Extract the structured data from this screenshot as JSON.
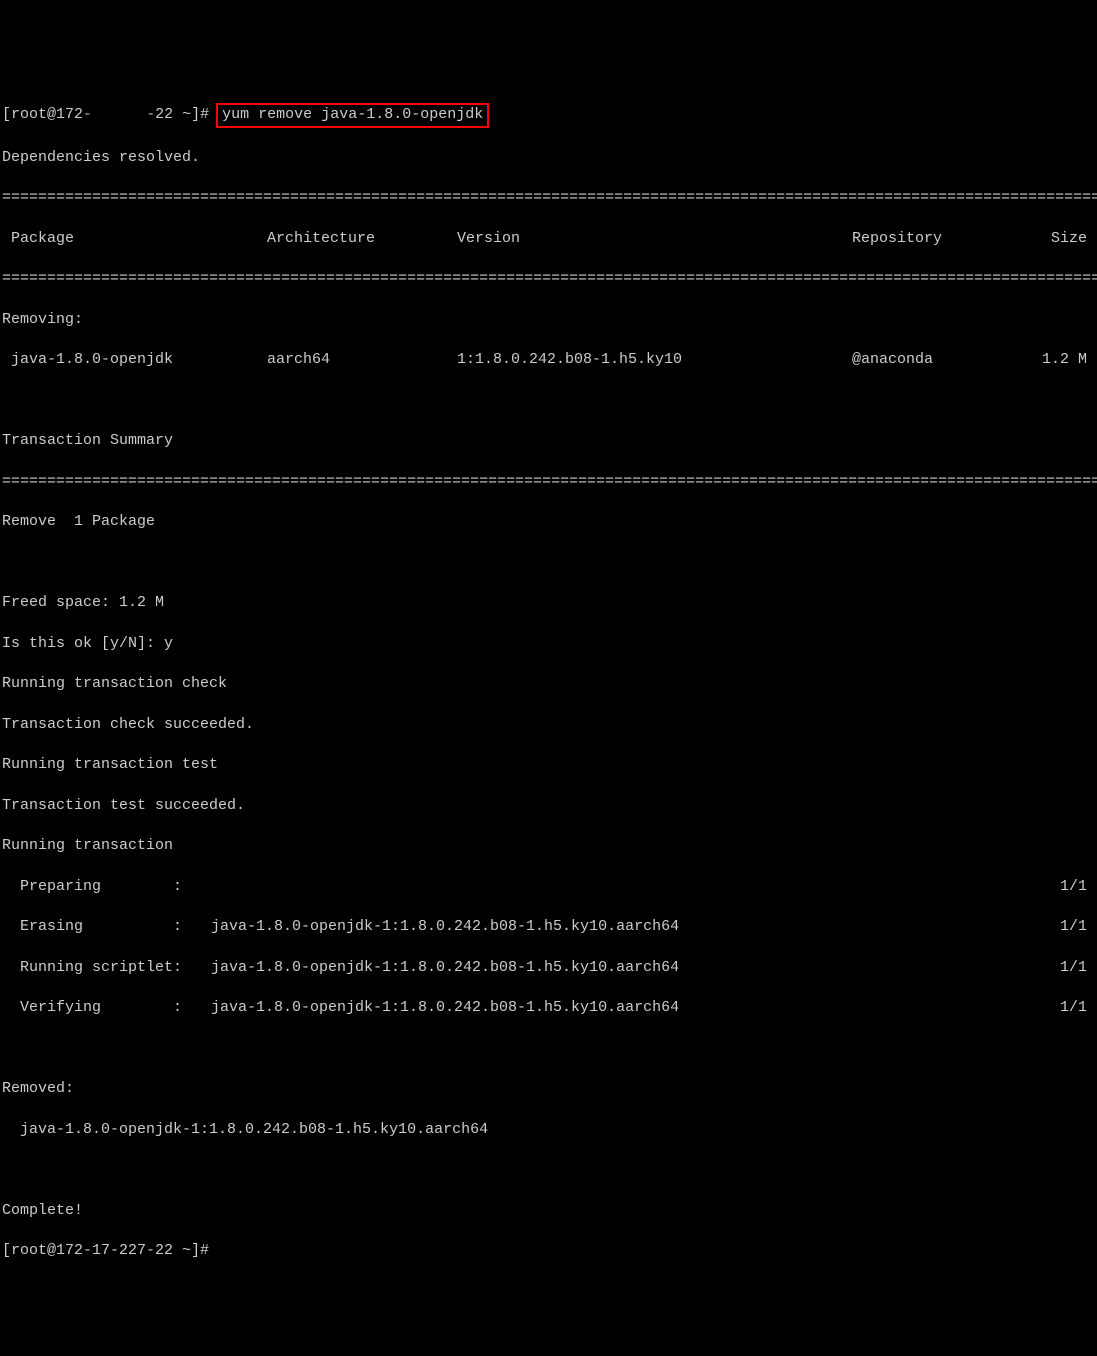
{
  "prompt1": {
    "user": "root",
    "host_prefix": "172-",
    "host_redacted": "17-227",
    "host_suffix": "-22",
    "path": "~",
    "symbol": "#",
    "command": "yum remove java-1.8.0-openjdk"
  },
  "deps_resolved": "Dependencies resolved.",
  "divider_single": "=================================================================================================================================",
  "headers": {
    "package": " Package",
    "arch": "Architecture",
    "version": "Version",
    "repo": "Repository",
    "size": "Size"
  },
  "section_removing": "Removing:",
  "package_row": {
    "name": " java-1.8.0-openjdk",
    "arch": "aarch64",
    "version": "1:1.8.0.242.b08-1.h5.ky10",
    "repo": "@anaconda",
    "size": "1.2 M"
  },
  "transaction_summary": "Transaction Summary",
  "remove_count": "Remove  1 Package",
  "freed_space": "Freed space: 1.2 M",
  "confirm": "Is this ok [y/N]: y",
  "run_check": "Running transaction check",
  "check_ok": "Transaction check succeeded.",
  "run_test": "Running transaction test",
  "test_ok": "Transaction test succeeded.",
  "run_trans": "Running transaction",
  "steps": {
    "preparing": {
      "label": "  Preparing        :",
      "pkg": " ",
      "count": "1/1"
    },
    "erasing": {
      "label": "  Erasing          :",
      "pkg": " java-1.8.0-openjdk-1:1.8.0.242.b08-1.h5.ky10.aarch64",
      "count": "1/1"
    },
    "scriptlet": {
      "label": "  Running scriptlet:",
      "pkg": " java-1.8.0-openjdk-1:1.8.0.242.b08-1.h5.ky10.aarch64",
      "count": "1/1"
    },
    "verifying": {
      "label": "  Verifying        :",
      "pkg": " java-1.8.0-openjdk-1:1.8.0.242.b08-1.h5.ky10.aarch64",
      "count": "1/1"
    }
  },
  "removed_header": "Removed:",
  "removed_pkg": "  java-1.8.0-openjdk-1:1.8.0.242.b08-1.h5.ky10.aarch64",
  "complete": "Complete!",
  "prompt2": "[root@172-17-227-22 ~]# "
}
